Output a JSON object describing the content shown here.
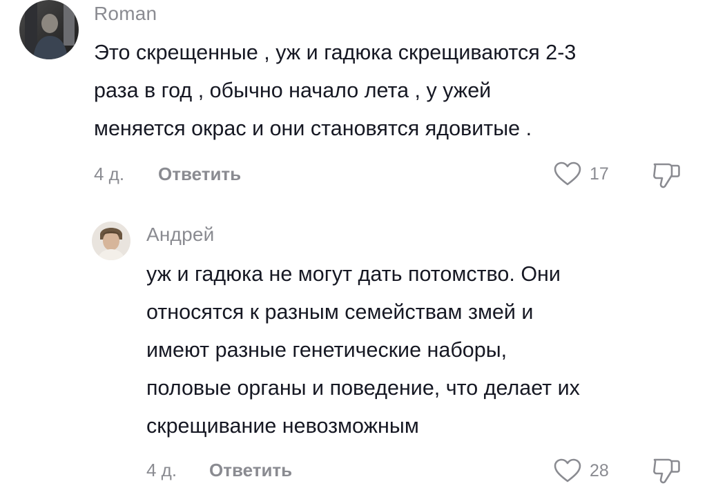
{
  "comments": [
    {
      "author": "Roman",
      "lines": [
        "Это скрещенные , уж и гадюка скрещиваются 2-3",
        "раза в год , обычно начало лета , у ужей",
        "меняется окрас и они становятся ядовитые ."
      ],
      "time": "4 д.",
      "reply_label": "Ответить",
      "likes": "17",
      "avatar_icon": "user-photo-dark",
      "like_icon": "heart-outline-icon",
      "dislike_icon": "thumbs-down-icon"
    },
    {
      "author": "Андрей",
      "lines": [
        "уж и гадюка не могут дать потомство. Они",
        "относятся к разным семействам змей и",
        "имеют разные генетические наборы,",
        "половые органы и поведение, что делает их",
        "скрещивание невозможным"
      ],
      "time": "4 д.",
      "reply_label": "Ответить",
      "likes": "28",
      "avatar_icon": "user-photo-light",
      "like_icon": "heart-outline-icon",
      "dislike_icon": "thumbs-down-icon"
    }
  ],
  "colors": {
    "text": "#161823",
    "meta": "#8a8b91"
  }
}
